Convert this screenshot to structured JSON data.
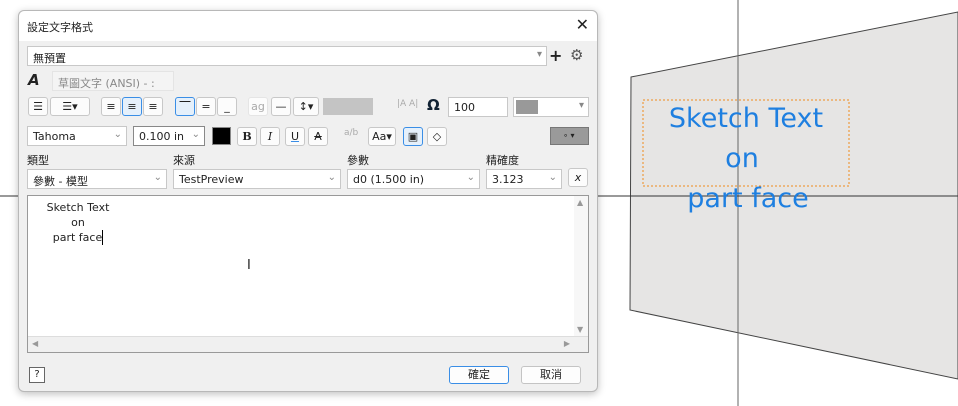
{
  "dialog": {
    "title": "設定文字格式",
    "style_preset": "無預置",
    "text_style": "草圖文字 (ANSI) - :",
    "width_scale": "100",
    "font": "Tahoma",
    "font_size": "0.100 in",
    "labels": {
      "type": "類型",
      "source": "來源",
      "parameter": "參數",
      "precision": "精確度"
    },
    "type_value": "參數 - 模型",
    "source_value": "TestPreview",
    "parameter_value": "d0 (1.500 in)",
    "precision_value": "3.123",
    "editor_lines": [
      "Sketch Text",
      "on",
      "part face"
    ],
    "ok_label": "確定",
    "cancel_label": "取消",
    "format_buttons": {
      "bold": "B",
      "italic": "I",
      "underline": "U",
      "strike": "A"
    }
  },
  "canvas": {
    "sketch_text_lines": [
      "Sketch Text",
      "on",
      "part face"
    ],
    "text_color": "#1e7fe0",
    "face_color": "#e6e5e4",
    "box_color": "#f08a1c"
  }
}
